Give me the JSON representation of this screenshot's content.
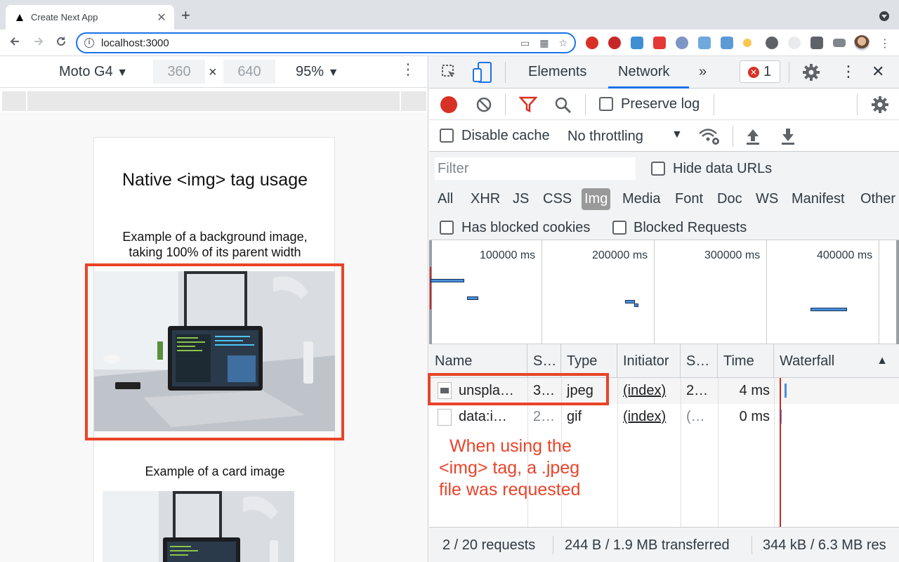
{
  "browser": {
    "tab_title": "Create Next App",
    "tab_close": "✕",
    "new_tab": "+",
    "url": "localhost:3000",
    "back_icon": "arrow-left-icon",
    "forward_icon": "arrow-right-icon",
    "reload_icon": "reload-icon"
  },
  "device_toolbar": {
    "device": "Moto G4",
    "width": "360",
    "height": "640",
    "times": "×",
    "zoom": "95%"
  },
  "page": {
    "heading": "Native <img> tag usage",
    "caption1_line1": "Example of a background image,",
    "caption1_line2": "taking 100% of its parent width",
    "caption2": "Example of a card image"
  },
  "devtools": {
    "tabs": [
      "Elements",
      "Network"
    ],
    "more_tabs": "»",
    "error_count": "1",
    "preserve_log": "Preserve log",
    "disable_cache": "Disable cache",
    "throttling": "No throttling",
    "filter_placeholder": "Filter",
    "hide_data_urls": "Hide data URLs",
    "types": [
      "All",
      "XHR",
      "JS",
      "CSS",
      "Img",
      "Media",
      "Font",
      "Doc",
      "WS",
      "Manifest",
      "Other"
    ],
    "active_type": "Img",
    "has_blocked_cookies": "Has blocked cookies",
    "blocked_requests": "Blocked Requests",
    "overview_labels": [
      "100000 ms",
      "200000 ms",
      "300000 ms",
      "400000 ms"
    ],
    "columns": [
      "Name",
      "S…",
      "Type",
      "Initiator",
      "S…",
      "Time",
      "Waterfall"
    ],
    "rows": [
      {
        "name": "unspla…",
        "status": "3…",
        "type": "jpeg",
        "initiator": "(index)",
        "size": "2…",
        "time": "4 ms"
      },
      {
        "name": "data:i…",
        "status": "2…",
        "type": "gif",
        "initiator": "(index)",
        "size": "(…",
        "time": "0 ms"
      }
    ],
    "status": {
      "requests": "2 / 20 requests",
      "transferred": "244 B / 1.9 MB transferred",
      "resources": "344 kB / 6.3 MB res"
    }
  },
  "annotation": {
    "line1": "When using the",
    "line2": "<img> tag, a .jpeg",
    "line3": "file was requested"
  },
  "colors": {
    "accent": "#1a73e8",
    "highlight_red": "#e84427",
    "record_red": "#d93025"
  }
}
